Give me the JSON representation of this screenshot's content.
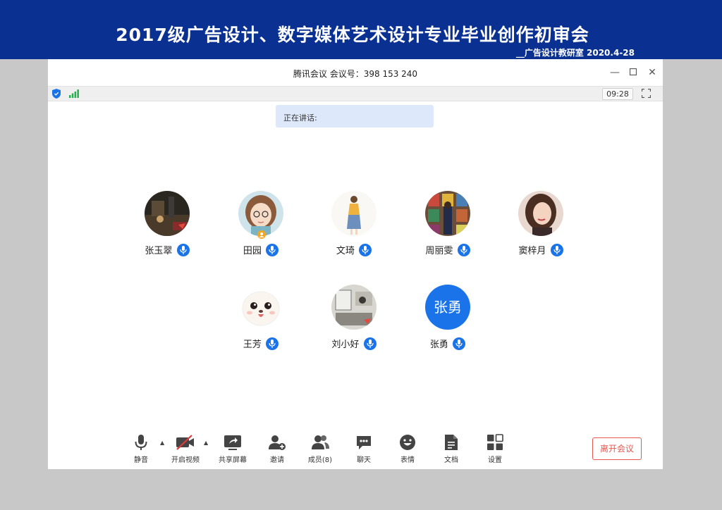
{
  "banner": {
    "title": "2017级广告设计、数字媒体艺术设计专业毕业创作初审会",
    "subtitle": "__广告设计教研室  2020.4-28"
  },
  "window": {
    "title": "腾讯会议 会议号：398 153 240",
    "timer": "09:28",
    "speaking": "正在讲话:",
    "controls": {
      "minimize": "—",
      "maximize": "☐",
      "close": "✕"
    }
  },
  "participants": [
    {
      "name": "张玉翠",
      "avatar": "photo-night-scene"
    },
    {
      "name": "田园",
      "avatar": "cartoon-girl"
    },
    {
      "name": "文琦",
      "avatar": "illustration-woman"
    },
    {
      "name": "周丽雯",
      "avatar": "photo-colorful-windows"
    },
    {
      "name": "窦梓月",
      "avatar": "photo-portrait"
    },
    {
      "name": "王芳",
      "avatar": "cartoon-face"
    },
    {
      "name": "刘小好",
      "avatar": "photo-sketch"
    },
    {
      "name": "张勇",
      "avatar_text": "张勇",
      "avatar_color": "#1a73e8"
    }
  ],
  "toolbar": {
    "mute": "静音",
    "video": "开启视频",
    "share": "共享屏幕",
    "invite": "邀请",
    "members": "成员(8)",
    "chat": "聊天",
    "emoji": "表情",
    "docs": "文档",
    "settings": "设置",
    "leave": "离开会议"
  },
  "colors": {
    "banner": "#0a3192",
    "accent": "#1a73e8",
    "leave": "#e8574f"
  }
}
